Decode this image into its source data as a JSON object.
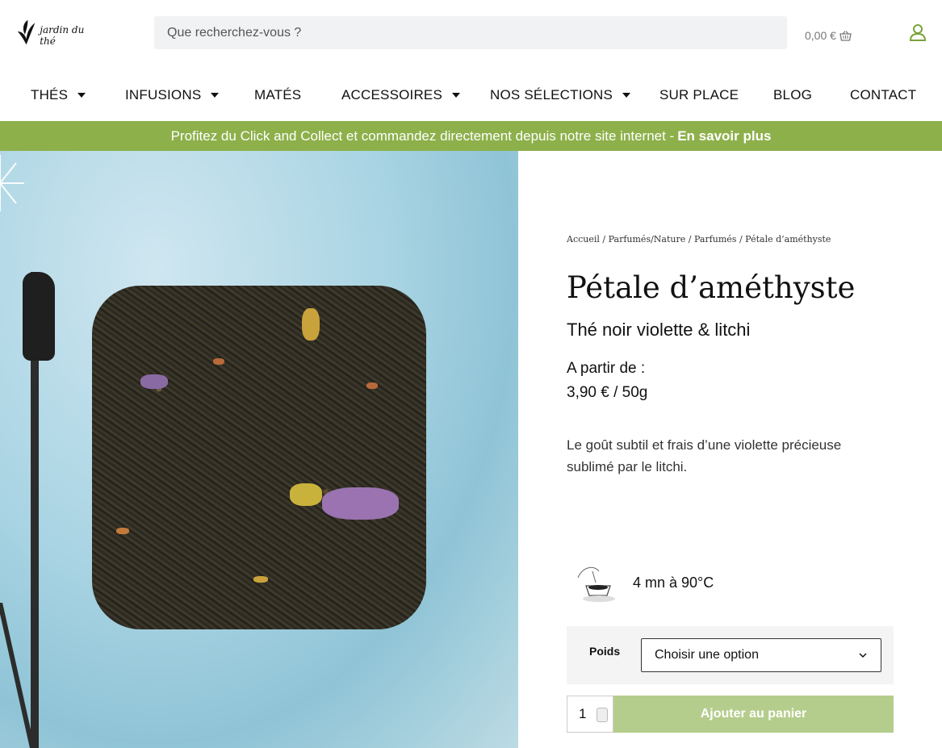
{
  "brand": {
    "name": "jardin du thé"
  },
  "search": {
    "placeholder": "Que recherchez-vous ?"
  },
  "cart": {
    "amount": "0,00 €"
  },
  "nav": {
    "items": [
      {
        "label": "THÉS",
        "dropdown": true
      },
      {
        "label": "INFUSIONS",
        "dropdown": true
      },
      {
        "label": "MATÉS",
        "dropdown": false
      },
      {
        "label": "ACCESSOIRES",
        "dropdown": true
      },
      {
        "label": "NOS SÉLECTIONS",
        "dropdown": true
      },
      {
        "label": "SUR PLACE",
        "dropdown": false
      },
      {
        "label": "BLOG",
        "dropdown": false
      },
      {
        "label": "CONTACT",
        "dropdown": false
      }
    ]
  },
  "banner": {
    "text": "Profitez du Click and Collect et commandez directement depuis notre site internet -",
    "link": "En savoir plus",
    "color": "#8db04a"
  },
  "breadcrumb": {
    "items": [
      "Accueil",
      "Parfumés/Nature",
      "Parfumés"
    ],
    "current": "Pétale d’améthyste",
    "separator": "/"
  },
  "product": {
    "title": "Pétale d’améthyste",
    "subtitle": "Thé noir violette & litchi",
    "price_label": "A partir de :",
    "price": "3,90 € / 50g",
    "description": "Le goût subtil et frais d’une violette précieuse sublimé par le litchi.",
    "brewing": "4 mn à 90°C"
  },
  "options": {
    "label": "Poids",
    "selected": "Choisir une option"
  },
  "purchase": {
    "quantity": "1",
    "add_label": "Ajouter au panier",
    "button_color": "#b5cd8c"
  }
}
